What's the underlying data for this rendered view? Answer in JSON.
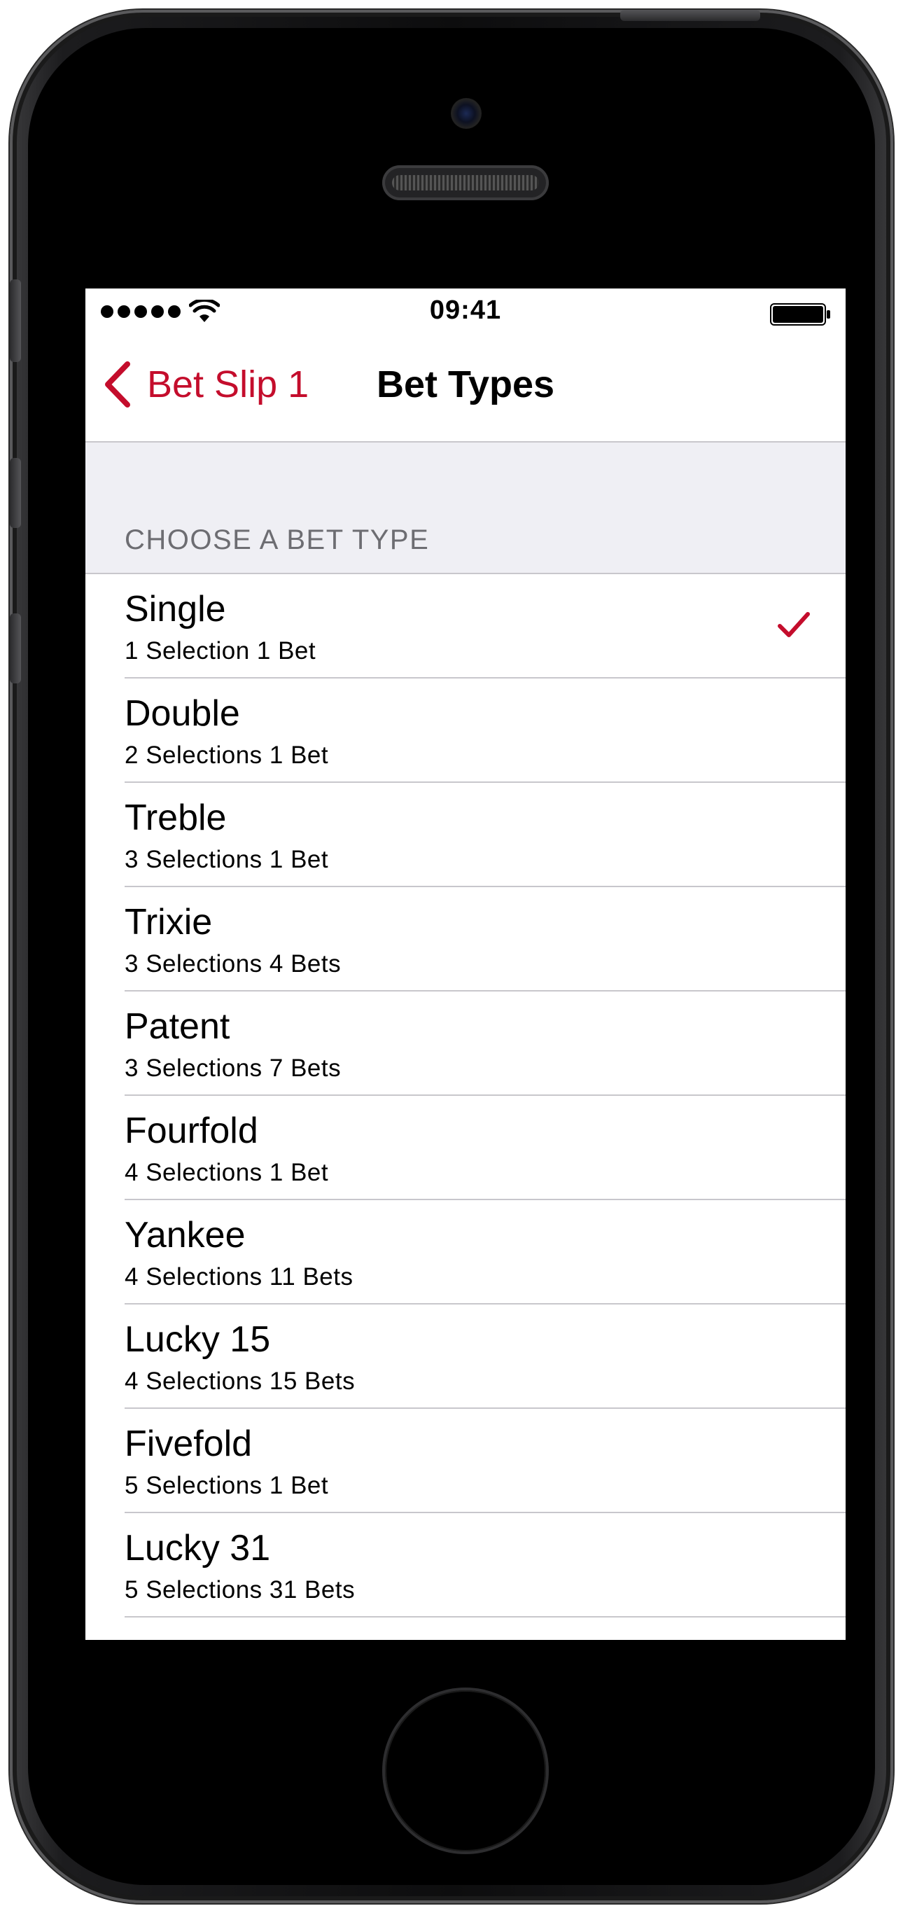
{
  "status_bar": {
    "time": "09:41"
  },
  "nav": {
    "back_label": "Bet Slip 1",
    "title": "Bet Types"
  },
  "section": {
    "header": "CHOOSE A BET TYPE"
  },
  "bet_types": [
    {
      "name": "Single",
      "description": "1 Selection 1 Bet",
      "selected": true
    },
    {
      "name": "Double",
      "description": "2 Selections 1 Bet",
      "selected": false
    },
    {
      "name": "Treble",
      "description": "3 Selections 1 Bet",
      "selected": false
    },
    {
      "name": "Trixie",
      "description": "3 Selections 4 Bets",
      "selected": false
    },
    {
      "name": "Patent",
      "description": "3 Selections 7 Bets",
      "selected": false
    },
    {
      "name": "Fourfold",
      "description": "4 Selections 1 Bet",
      "selected": false
    },
    {
      "name": "Yankee",
      "description": "4 Selections 11 Bets",
      "selected": false
    },
    {
      "name": "Lucky 15",
      "description": "4 Selections 15 Bets",
      "selected": false
    },
    {
      "name": "Fivefold",
      "description": "5 Selections 1 Bet",
      "selected": false
    },
    {
      "name": "Lucky 31",
      "description": "5 Selections 31 Bets",
      "selected": false
    }
  ],
  "icons": {
    "back": "chevron-left-icon",
    "selected": "checkmark-icon",
    "signal": "signal-dots-icon",
    "wifi": "wifi-icon",
    "battery": "battery-icon"
  },
  "colors": {
    "accent": "#c40d2c",
    "section_background": "#efeff4",
    "section_text": "#6d6d72",
    "separator": "#c8c7cc"
  }
}
